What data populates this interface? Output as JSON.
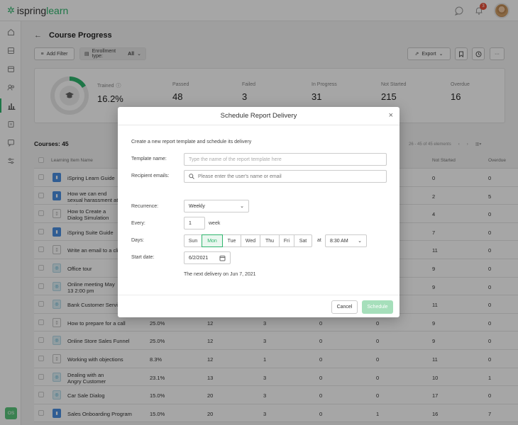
{
  "app": {
    "logo_text_a": "ispring",
    "logo_text_b": "learn",
    "notification_count": "3"
  },
  "sidebar": {
    "items": [
      "home-icon",
      "inbox-icon",
      "calendar-icon",
      "users-icon",
      "reports-icon",
      "content-icon",
      "message-icon",
      "settings-icon"
    ],
    "active_index": 4,
    "user_initials": "OS"
  },
  "page": {
    "title": "Course Progress"
  },
  "toolbar": {
    "add_filter": "Add Filter",
    "enrollment_label": "Enrollment type:",
    "enrollment_value": "All",
    "export": "Export"
  },
  "stats": {
    "trained_fraction": 0.162,
    "items": [
      {
        "label": "Trained",
        "value": "16.2%"
      },
      {
        "label": "Passed",
        "value": "48"
      },
      {
        "label": "Failed",
        "value": "3"
      },
      {
        "label": "In Progress",
        "value": "31"
      },
      {
        "label": "Not Started",
        "value": "215"
      },
      {
        "label": "Overdue",
        "value": "16"
      }
    ]
  },
  "courses": {
    "heading": "Courses: 45",
    "pager": "26 - 45 of 45 elements",
    "columns": {
      "name": "Learning Item Name",
      "not_started": "Not Started",
      "overdue": "Overdue"
    },
    "rows": [
      {
        "icon": "blue",
        "name": "iSpring Learn Guide",
        "pct": "",
        "c1": "",
        "c2": "",
        "c3": "",
        "c4": "",
        "not_started": "0",
        "overdue": "0"
      },
      {
        "icon": "blue",
        "name": "How we can end sexual harassment at work - G",
        "pct": "",
        "c1": "",
        "c2": "",
        "c3": "",
        "c4": "",
        "not_started": "2",
        "overdue": "5"
      },
      {
        "icon": "outline",
        "name": "How to Create a Dialog Simulation",
        "pct": "",
        "c1": "",
        "c2": "",
        "c3": "",
        "c4": "",
        "not_started": "4",
        "overdue": "0"
      },
      {
        "icon": "blue",
        "name": "iSpring Suite Guide",
        "pct": "",
        "c1": "",
        "c2": "",
        "c3": "",
        "c4": "",
        "not_started": "7",
        "overdue": "0"
      },
      {
        "icon": "outline",
        "name": "Write an email to a clie",
        "pct": "",
        "c1": "",
        "c2": "",
        "c3": "",
        "c4": "",
        "not_started": "11",
        "overdue": "0"
      },
      {
        "icon": "teal",
        "name": "Office tour",
        "pct": "",
        "c1": "",
        "c2": "",
        "c3": "",
        "c4": "",
        "not_started": "9",
        "overdue": "0"
      },
      {
        "icon": "teal",
        "name": "Online meeting May 13 2:00 pm",
        "pct": "",
        "c1": "",
        "c2": "",
        "c3": "",
        "c4": "",
        "not_started": "9",
        "overdue": "0"
      },
      {
        "icon": "teal",
        "name": "Bank Customer Servic",
        "pct": "",
        "c1": "",
        "c2": "",
        "c3": "",
        "c4": "",
        "not_started": "11",
        "overdue": "0"
      },
      {
        "icon": "outline",
        "name": "How to prepare for a call",
        "pct": "25.0%",
        "c1": "12",
        "c2": "3",
        "c3": "0",
        "c4": "0",
        "not_started": "9",
        "overdue": "0"
      },
      {
        "icon": "teal",
        "name": "Online Store Sales Funnel",
        "pct": "25.0%",
        "c1": "12",
        "c2": "3",
        "c3": "0",
        "c4": "0",
        "not_started": "9",
        "overdue": "0"
      },
      {
        "icon": "outline",
        "name": "Working with objections",
        "pct": "8.3%",
        "c1": "12",
        "c2": "1",
        "c3": "0",
        "c4": "0",
        "not_started": "11",
        "overdue": "0"
      },
      {
        "icon": "teal",
        "name": "Dealing with an Angry Customer",
        "pct": "23.1%",
        "c1": "13",
        "c2": "3",
        "c3": "0",
        "c4": "0",
        "not_started": "10",
        "overdue": "1"
      },
      {
        "icon": "teal",
        "name": "Car Sale Dialog",
        "pct": "15.0%",
        "c1": "20",
        "c2": "3",
        "c3": "0",
        "c4": "0",
        "not_started": "17",
        "overdue": "0"
      },
      {
        "icon": "blue",
        "name": "Sales Onboarding Program",
        "pct": "15.0%",
        "c1": "20",
        "c2": "3",
        "c3": "0",
        "c4": "1",
        "not_started": "16",
        "overdue": "7"
      }
    ]
  },
  "modal": {
    "title": "Schedule Report Delivery",
    "description": "Create a new report template and schedule its delivery",
    "template_label": "Template name:",
    "template_placeholder": "Type the name of the report template here",
    "recipients_label": "Recipient emails:",
    "recipients_placeholder": "Please enter the user's name or email",
    "recurrence_label": "Recurrence:",
    "recurrence_value": "Weekly",
    "every_label": "Every:",
    "every_value": "1",
    "every_unit": "week",
    "days_label": "Days:",
    "days": [
      "Sun",
      "Mon",
      "Tue",
      "Wed",
      "Thu",
      "Fri",
      "Sat"
    ],
    "selected_day": "Mon",
    "at_label": "at",
    "time_value": "8:30 AM",
    "start_label": "Start date:",
    "start_value": "6/2/2021",
    "next_delivery": "The next delivery on Jun 7, 2021",
    "cancel": "Cancel",
    "schedule": "Schedule"
  }
}
